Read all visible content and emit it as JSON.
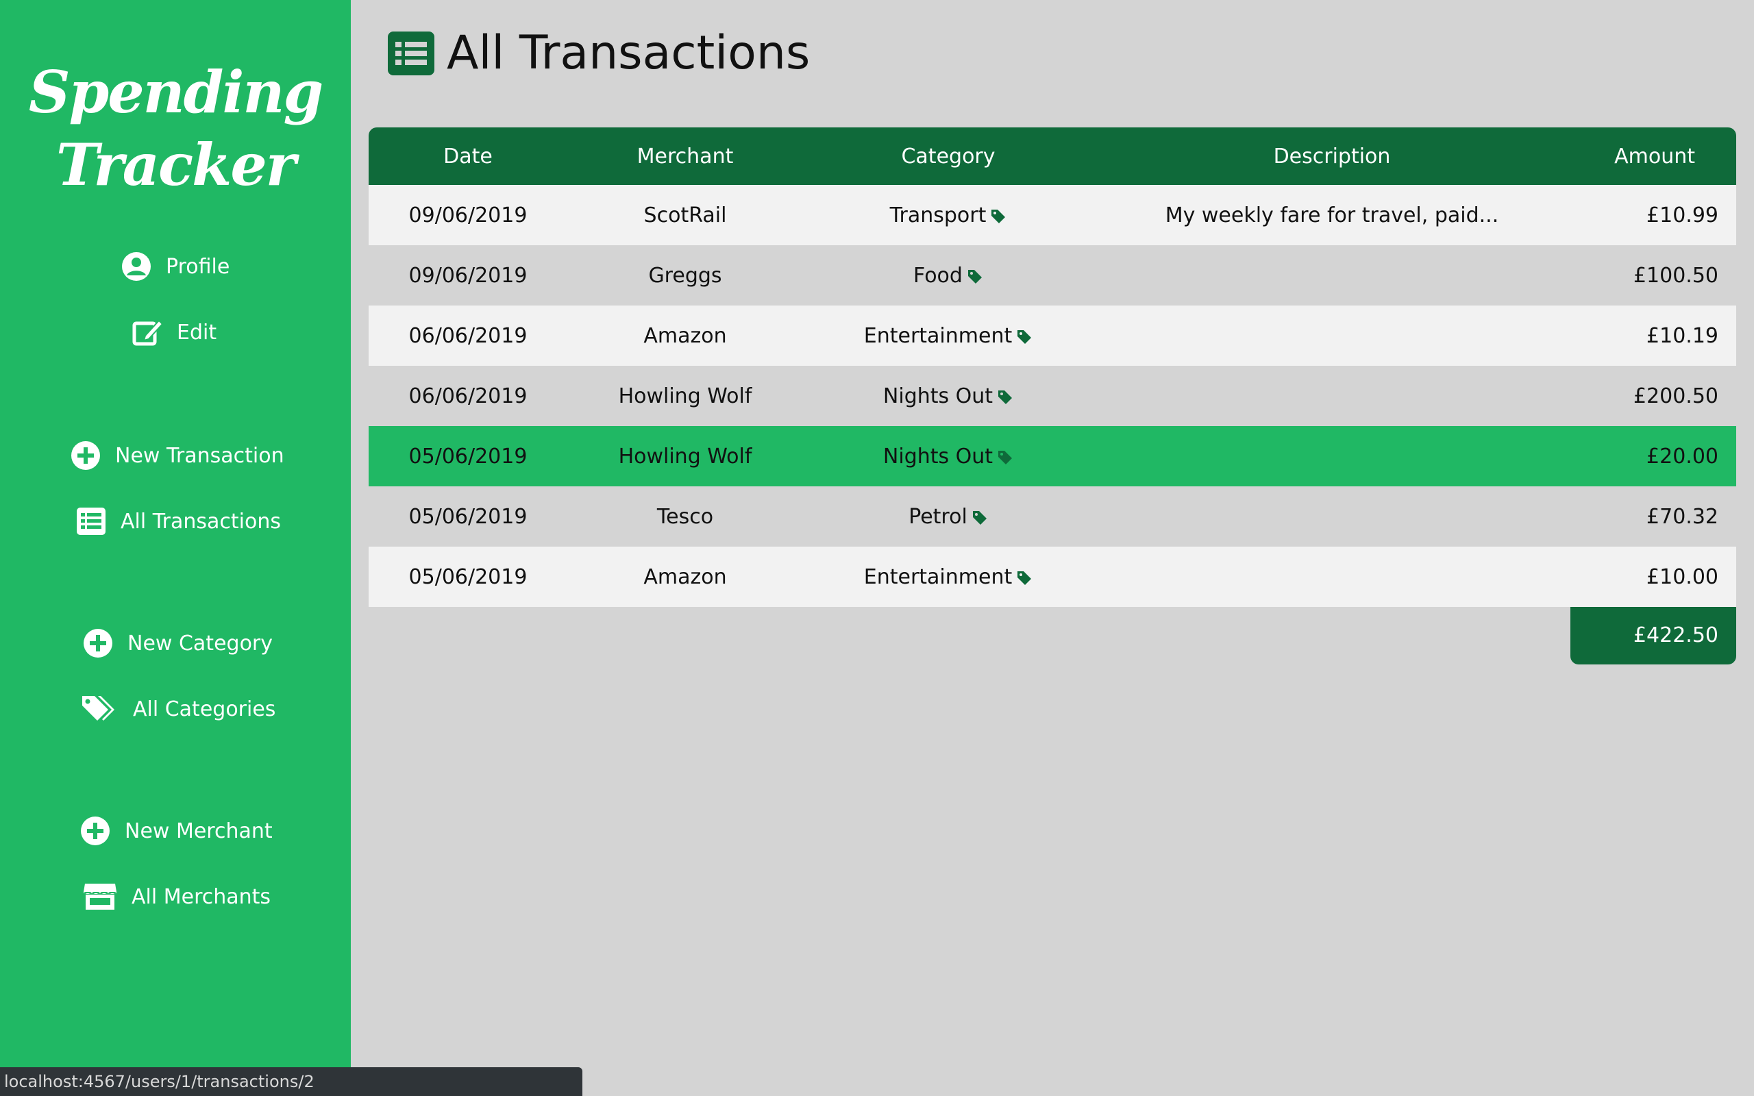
{
  "sidebar": {
    "logo_line1": "Spending",
    "logo_line2": "Tracker",
    "items": [
      {
        "label": "Profile",
        "icon": "user-circle-icon"
      },
      {
        "label": "Edit",
        "icon": "edit-icon"
      },
      {
        "label": "New Transaction",
        "icon": "plus-circle-icon"
      },
      {
        "label": "All Transactions",
        "icon": "list-icon"
      },
      {
        "label": "New Category",
        "icon": "plus-circle-icon"
      },
      {
        "label": "All Categories",
        "icon": "tags-icon"
      },
      {
        "label": "New Merchant",
        "icon": "plus-circle-icon"
      },
      {
        "label": "All Merchants",
        "icon": "store-icon"
      }
    ]
  },
  "page": {
    "title": "All Transactions",
    "title_icon": "list-icon"
  },
  "table": {
    "headers": [
      "Date",
      "Merchant",
      "Category",
      "Description",
      "Amount"
    ],
    "rows": [
      {
        "date": "09/06/2019",
        "merchant": "ScotRail",
        "category": "Transport",
        "description": "My weekly fare for travel, paid...",
        "amount": "£10.99"
      },
      {
        "date": "09/06/2019",
        "merchant": "Greggs",
        "category": "Food",
        "description": "",
        "amount": "£100.50"
      },
      {
        "date": "06/06/2019",
        "merchant": "Amazon",
        "category": "Entertainment",
        "description": "",
        "amount": "£10.19"
      },
      {
        "date": "06/06/2019",
        "merchant": "Howling Wolf",
        "category": "Nights Out",
        "description": "",
        "amount": "£200.50"
      },
      {
        "date": "05/06/2019",
        "merchant": "Howling Wolf",
        "category": "Nights Out",
        "description": "",
        "amount": "£20.00",
        "highlighted": true
      },
      {
        "date": "05/06/2019",
        "merchant": "Tesco",
        "category": "Petrol",
        "description": "",
        "amount": "£70.32"
      },
      {
        "date": "05/06/2019",
        "merchant": "Amazon",
        "category": "Entertainment",
        "description": "",
        "amount": "£10.00"
      }
    ],
    "total": "£422.50"
  },
  "status_bar": {
    "url": "localhost:4567/users/1/transactions/2"
  },
  "colors": {
    "sidebar_green": "#20b864",
    "header_dark_green": "#0f6a3a",
    "background": "#d4d4d4",
    "row_light": "#f2f2f2"
  }
}
